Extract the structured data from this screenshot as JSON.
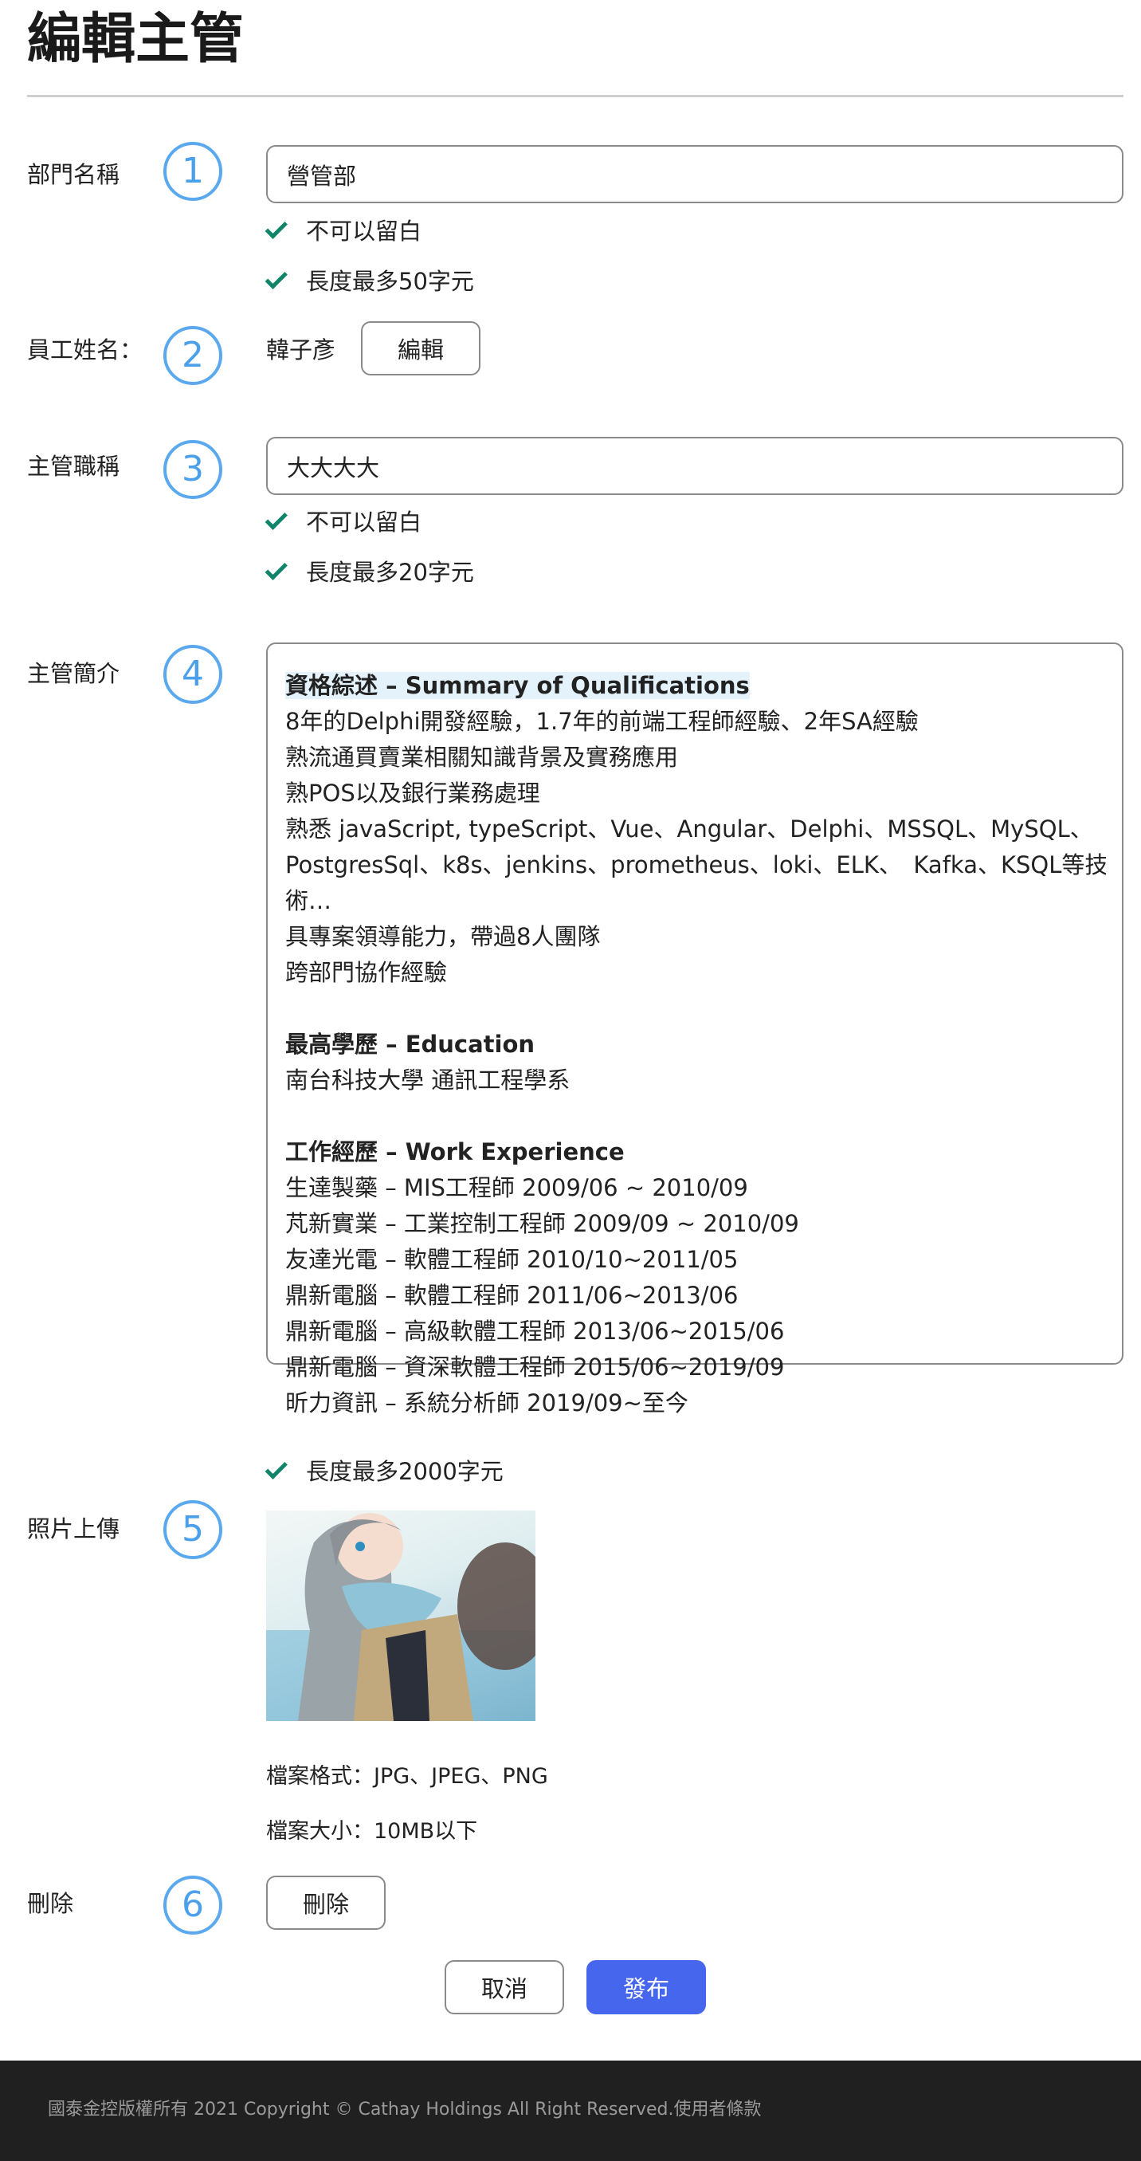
{
  "page": {
    "title": "編輯主管"
  },
  "form": {
    "department": {
      "step": "1",
      "label": "部門名稱",
      "value": "營管部",
      "rules": [
        "不可以留白",
        "長度最多50字元"
      ]
    },
    "employee": {
      "step": "2",
      "label": "員工姓名：",
      "value": "韓子彥",
      "edit_button": "編輯"
    },
    "job_title": {
      "step": "3",
      "label": "主管職稱",
      "value": "大大大大",
      "rules": [
        "不可以留白",
        "長度最多20字元"
      ]
    },
    "bio": {
      "step": "4",
      "label": "主管簡介",
      "lines": [
        "資格綜述 – Summary of Qualifications",
        "8年的Delphi開發經驗，1.7年的前端工程師經驗、2年SA經驗",
        "熟流通買賣業相關知識背景及實務應用",
        "熟POS以及銀行業務處理",
        "熟悉 javaScript, typeScript、Vue、Angular、Delphi、MSSQL、MySQL、",
        "PostgresSql、k8s、jenkins、prometheus、loki、ELK、　Kafka、KSQL等技",
        "術…",
        "具專案領導能力，帶過8人團隊",
        "跨部門協作經驗",
        "",
        "最高學歷 – Education",
        "南台科技大學 通訊工程學系",
        "",
        "工作經歷 – Work Experience",
        "生達製藥 – MIS工程師 2009/06 ~ 2010/09",
        "芃新實業 – 工業控制工程師 2009/09 ~ 2010/09",
        "友達光電 – 軟體工程師 2010/10~2011/05",
        "鼎新電腦 – 軟體工程師 2011/06~2013/06",
        "鼎新電腦 – 高級軟體工程師 2013/06~2015/06",
        "鼎新電腦 – 資深軟體工程師 2015/06~2019/09",
        "昕力資訊 – 系統分析師 2019/09~至今"
      ],
      "rule": "長度最多2000字元"
    },
    "photo": {
      "step": "5",
      "label": "照片上傳",
      "format_note": "檔案格式：JPG、JPEG、PNG",
      "size_note": "檔案大小：10MB以下"
    },
    "delete": {
      "step": "6",
      "label": "刪除",
      "button": "刪除"
    }
  },
  "actions": {
    "cancel": "取消",
    "publish": "發布"
  },
  "footer": {
    "text": "國泰金控版權所有 2021 Copyright © Cathay Holdings All Right Reserved.使用者條款"
  },
  "colors": {
    "primary": "#4766ee",
    "check": "#11856a",
    "step_circle": "#5aa9ee",
    "footer_bg": "#202020"
  }
}
